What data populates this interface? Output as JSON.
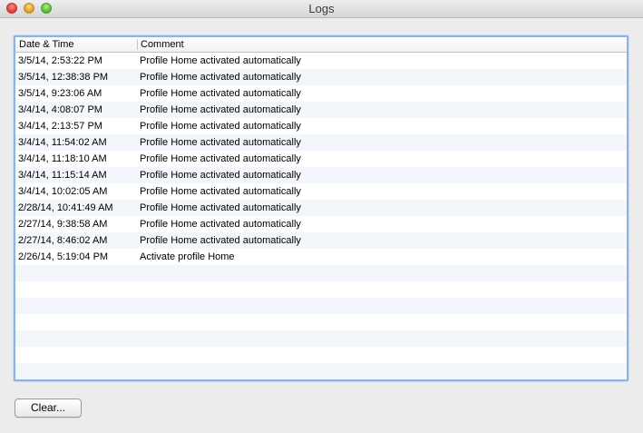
{
  "window": {
    "title": "Logs"
  },
  "table": {
    "columns": [
      "Date & Time",
      "Comment"
    ],
    "rows": [
      {
        "datetime": "3/5/14, 2:53:22 PM",
        "comment": "Profile Home activated automatically"
      },
      {
        "datetime": "3/5/14, 12:38:38 PM",
        "comment": "Profile Home activated automatically"
      },
      {
        "datetime": "3/5/14, 9:23:06 AM",
        "comment": "Profile Home activated automatically"
      },
      {
        "datetime": "3/4/14, 4:08:07 PM",
        "comment": "Profile Home activated automatically"
      },
      {
        "datetime": "3/4/14, 2:13:57 PM",
        "comment": "Profile Home activated automatically"
      },
      {
        "datetime": "3/4/14, 11:54:02 AM",
        "comment": "Profile Home activated automatically"
      },
      {
        "datetime": "3/4/14, 11:18:10 AM",
        "comment": "Profile Home activated automatically"
      },
      {
        "datetime": "3/4/14, 11:15:14 AM",
        "comment": "Profile Home activated automatically"
      },
      {
        "datetime": "3/4/14, 10:02:05 AM",
        "comment": "Profile Home activated automatically"
      },
      {
        "datetime": "2/28/14, 10:41:49 AM",
        "comment": "Profile Home activated automatically"
      },
      {
        "datetime": "2/27/14, 9:38:58 AM",
        "comment": "Profile Home activated automatically"
      },
      {
        "datetime": "2/27/14, 8:46:02 AM",
        "comment": "Profile Home activated automatically"
      },
      {
        "datetime": "2/26/14, 5:19:04 PM",
        "comment": "Activate profile Home"
      }
    ]
  },
  "buttons": {
    "clear_label": "Clear..."
  },
  "colors": {
    "focus_ring": "#8db2e3",
    "alt_row": "#f3f6fa",
    "close": "#e0443e",
    "minimize": "#dea12f",
    "zoom": "#5bbf3a"
  }
}
